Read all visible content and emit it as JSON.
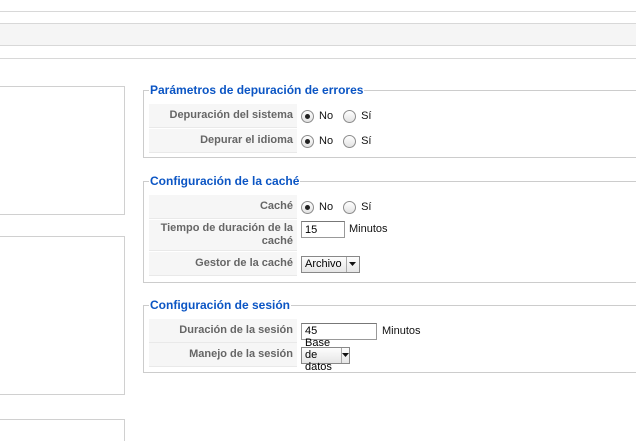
{
  "debug": {
    "legend": "Parámetros de depuración de errores",
    "rows": [
      {
        "label": "Depuración del sistema",
        "options": [
          "No",
          "Sí"
        ],
        "selected": "No"
      },
      {
        "label": "Depurar el idioma",
        "options": [
          "No",
          "Sí"
        ],
        "selected": "No"
      }
    ]
  },
  "cache": {
    "legend": "Configuración de la caché",
    "cache_label": "Caché",
    "cache_options": [
      "No",
      "Sí"
    ],
    "cache_selected": "No",
    "time_label": "Tiempo de duración de la caché",
    "time_value": "15",
    "time_unit": "Minutos",
    "handler_label": "Gestor de la caché",
    "handler_value": "Archivo"
  },
  "session": {
    "legend": "Configuración de sesión",
    "duration_label": "Duración de la sesión",
    "duration_value": "45",
    "duration_unit": "Minutos",
    "handler_label": "Manejo de la sesión",
    "handler_value": "Base de datos"
  }
}
